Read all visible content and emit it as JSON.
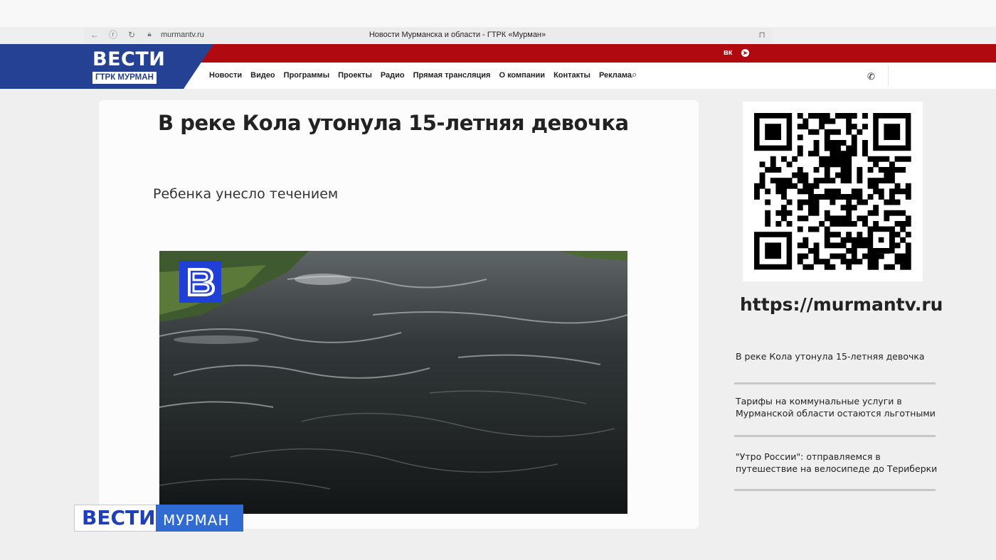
{
  "browser": {
    "url": "murmantv.ru",
    "page_title": "Новости Мурманска и области - ГТРК «Мурман»"
  },
  "header": {
    "logo_main": "ВЕСТИ",
    "logo_sub": "ГТРК МУРМАН",
    "social": [
      "вк",
      "tg"
    ],
    "nav": [
      "Новости",
      "Видео",
      "Программы",
      "Проекты",
      "Радио",
      "Прямая трансляция",
      "О компании",
      "Контакты",
      "Реклама"
    ],
    "colors": {
      "red_bar": "#b0090f",
      "logo_blue": "#244193"
    }
  },
  "article": {
    "headline": "В реке Кола утонула 15-летняя девочка",
    "subtitle": "Ребенка унесло течением"
  },
  "sidebar": {
    "url_text": "https://murmantv.ru",
    "news": [
      "В реке Кола утонула 15-летняя девочка",
      "Тарифы на коммунальные услуги в Мурманской области остаются льготными",
      "\"Утро России\": отправляемся в путешествие на велосипеде до Териберки"
    ]
  },
  "tv_overlay": {
    "vesti": "ВЕСТИ",
    "region": "МУРМАН"
  },
  "icons": [
    "back-icon",
    "shield-icon",
    "reload-icon",
    "lock-icon",
    "bookmark-icon",
    "vk-icon",
    "telegram-icon",
    "search-icon",
    "phone-icon",
    "qr-code",
    "vesti-b-logo"
  ]
}
